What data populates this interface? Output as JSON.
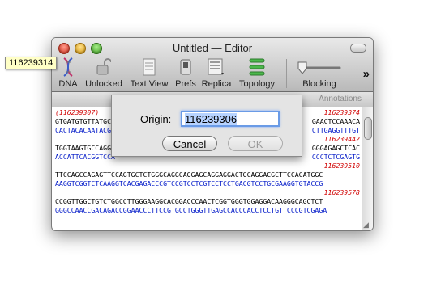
{
  "window": {
    "title": "Untitled — Editor"
  },
  "toolbar": {
    "items": [
      {
        "label": "DNA",
        "icon": "dna-icon"
      },
      {
        "label": "Unlocked",
        "icon": "unlocked-icon"
      },
      {
        "label": "Text View",
        "icon": "document-icon"
      },
      {
        "label": "Prefs",
        "icon": "switch-icon"
      },
      {
        "label": "Replica",
        "icon": "replica-icon"
      },
      {
        "label": "Topology",
        "icon": "topology-icon"
      },
      {
        "label": "Blocking",
        "icon": "slider-icon"
      }
    ],
    "overflow": "»"
  },
  "ruler": {
    "annotations_label": "Annotations"
  },
  "tooltip": {
    "text": "116239314"
  },
  "sequence": {
    "rows": [
      {
        "left": "(116239307)",
        "right": "116239374",
        "left_color": "red",
        "right_color": "red"
      },
      {
        "left": "GTGATGTGTTATGCG",
        "right": "GAACTCCAAACA",
        "left_color": "black",
        "right_color": "black"
      },
      {
        "left": "CACTACACAATACGC",
        "right": "CTTGAGGTTTGT",
        "left_color": "blue",
        "right_color": "blue"
      },
      {
        "left": "",
        "right": "116239442",
        "left_color": "red",
        "right_color": "red"
      },
      {
        "left": "TGGTAAGTGCCAGGT",
        "right": "GGGAGAGCTCAC",
        "left_color": "black",
        "right_color": "black"
      },
      {
        "left": "ACCATTCACGGTCCA",
        "right": "CCCTCTCGAGTG",
        "left_color": "blue",
        "right_color": "blue"
      },
      {
        "left": "",
        "right": "116239510",
        "left_color": "red",
        "right_color": "red"
      },
      {
        "left": "TTCCAGCCAGAGTTCCAGTGCTCTGGGCAGGCAGGAGCAGGAGGACTGCAGGACGCTTCCACATGGC",
        "right": "",
        "left_color": "black",
        "right_color": "black"
      },
      {
        "left": "AAGGTCGGTCTCAAGGTCACGAGACCCGTCCGTCCTCGTCCTCCTGACGTCCTGCGAAGGTGTACCG",
        "right": "",
        "left_color": "blue",
        "right_color": "blue"
      },
      {
        "left": "",
        "right": "116239578",
        "left_color": "red",
        "right_color": "red"
      },
      {
        "left": "CCGGTTGGCTGTCTGGCCTTGGGAAGGCACGGACCCAACTCGGTGGGTGGAGGACAAGGGCAGCTCT",
        "right": "",
        "left_color": "black",
        "right_color": "black"
      },
      {
        "left": "GGGCCAACCGACAGACCGGAACCCTTCCGTGCCTGGGTTGAGCCACCCACCTCCTGTTCCCGTCGAGA",
        "right": "",
        "left_color": "blue",
        "right_color": "blue"
      }
    ]
  },
  "dialog": {
    "origin_label": "Origin:",
    "origin_value": "116239306",
    "cancel_label": "Cancel",
    "ok_label": "OK"
  }
}
